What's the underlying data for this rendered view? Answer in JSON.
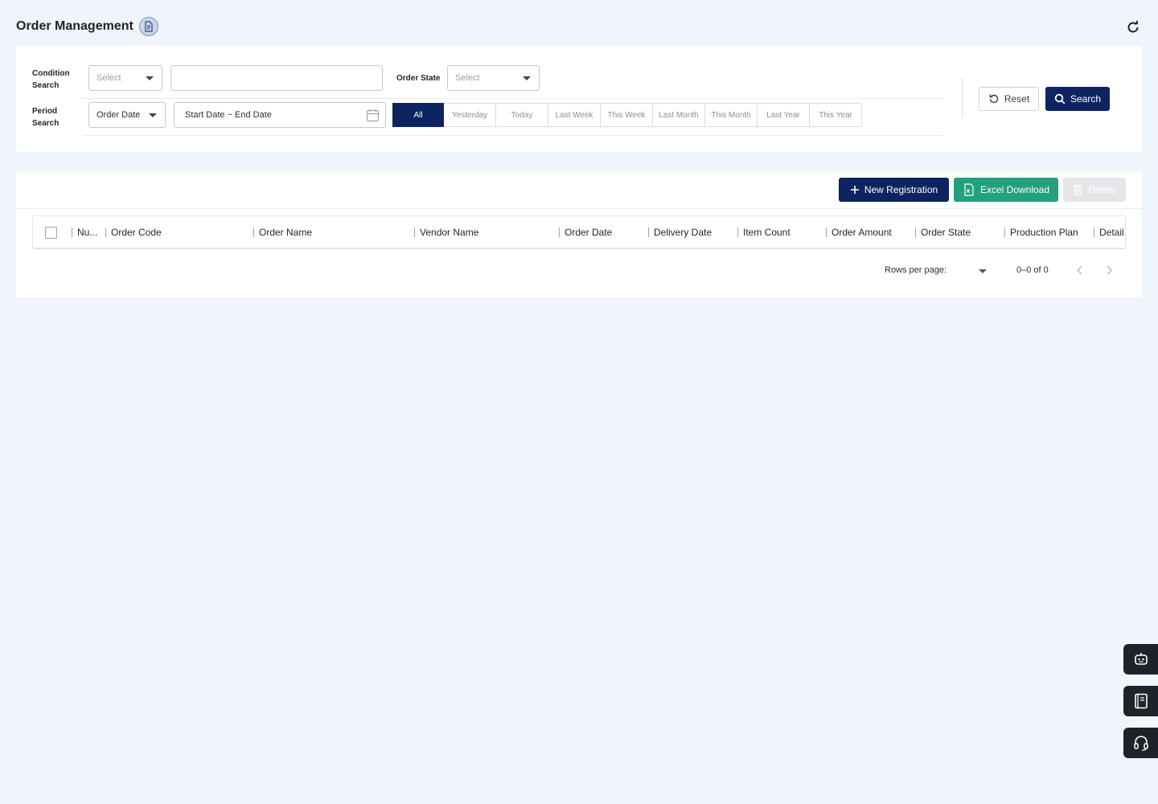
{
  "header": {
    "title": "Order Management"
  },
  "search": {
    "condition_label_1": "Condition",
    "condition_label_2": "Search",
    "condition_select": "Select",
    "condition_text": "",
    "order_state_label": "Order State",
    "order_state_select": "Select",
    "period_label_1": "Period",
    "period_label_2": "Search",
    "period_type": "Order Date",
    "date_range": "Start Date ~ End Date",
    "periods": [
      "All",
      "Yesterday",
      "Today",
      "Last Week",
      "This Week",
      "Last Month",
      "This Month",
      "Last Year",
      "This Year"
    ],
    "selected_period": "All",
    "reset_label": "Reset",
    "search_label": "Search"
  },
  "toolbar": {
    "new_label": "New Registration",
    "excel_label": "Excel Download",
    "delete_label": "Delete"
  },
  "table": {
    "columns": [
      "Nu...",
      "Order Code",
      "Order Name",
      "Vendor Name",
      "Order Date",
      "Delivery Date",
      "Item Count",
      "Order Amount",
      "Order State",
      "Production Plan",
      "Detail"
    ]
  },
  "pagination": {
    "rows_per_page_label": "Rows per page:",
    "range": "0–0 of 0"
  },
  "colors": {
    "primary": "#0e2461",
    "excel": "#23a07e",
    "background": "#f0f4fb"
  },
  "icons": [
    "document-icon",
    "refresh-icon",
    "calendar-icon",
    "reset-icon",
    "search-icon",
    "plus-icon",
    "excel-icon",
    "trash-icon",
    "chevron-left-icon",
    "chevron-right-icon",
    "chatbot-icon",
    "manual-book-icon",
    "headset-icon"
  ]
}
